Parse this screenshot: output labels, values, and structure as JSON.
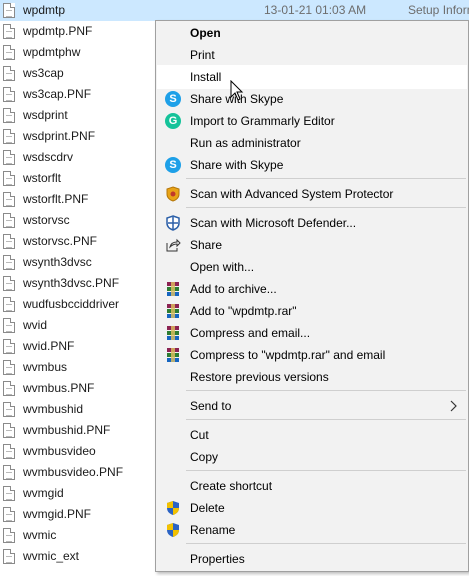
{
  "files": [
    {
      "name": "wpdmtp",
      "date": "13-01-21 01:03 AM",
      "type": "Setup Inform",
      "selected": true
    },
    {
      "name": "wpdmtp.PNF"
    },
    {
      "name": "wpdmtphw"
    },
    {
      "name": "ws3cap"
    },
    {
      "name": "ws3cap.PNF"
    },
    {
      "name": "wsdprint"
    },
    {
      "name": "wsdprint.PNF"
    },
    {
      "name": "wsdscdrv"
    },
    {
      "name": "wstorflt"
    },
    {
      "name": "wstorflt.PNF"
    },
    {
      "name": "wstorvsc"
    },
    {
      "name": "wstorvsc.PNF"
    },
    {
      "name": "wsynth3dvsc"
    },
    {
      "name": "wsynth3dvsc.PNF"
    },
    {
      "name": "wudfusbcciddriver"
    },
    {
      "name": "wvid"
    },
    {
      "name": "wvid.PNF"
    },
    {
      "name": "wvmbus"
    },
    {
      "name": "wvmbus.PNF"
    },
    {
      "name": "wvmbushid"
    },
    {
      "name": "wvmbushid.PNF"
    },
    {
      "name": "wvmbusvideo"
    },
    {
      "name": "wvmbusvideo.PNF"
    },
    {
      "name": "wvmgid"
    },
    {
      "name": "wvmgid.PNF"
    },
    {
      "name": "wvmic"
    },
    {
      "name": "wvmic_ext"
    }
  ],
  "menu": {
    "open": "Open",
    "print": "Print",
    "install": "Install",
    "share_skype_1": "Share with Skype",
    "grammarly": "Import to Grammarly Editor",
    "run_admin": "Run as administrator",
    "share_skype_2": "Share with Skype",
    "advanced_protector": "Scan with Advanced System Protector",
    "defender": "Scan with Microsoft Defender...",
    "share": "Share",
    "open_with": "Open with...",
    "add_archive": "Add to archive...",
    "add_rar": "Add to \"wpdmtp.rar\"",
    "compress_email": "Compress and email...",
    "compress_rar_email": "Compress to \"wpdmtp.rar\" and email",
    "restore": "Restore previous versions",
    "send_to": "Send to",
    "cut": "Cut",
    "copy": "Copy",
    "create_shortcut": "Create shortcut",
    "delete": "Delete",
    "rename": "Rename",
    "properties": "Properties"
  },
  "colors": {
    "selection": "#cce8ff",
    "menu_bg": "#f2f2f2",
    "skype": "#1ea0e8",
    "grammarly": "#15c39a"
  },
  "icons": {
    "skype": "S",
    "grammarly": "G"
  }
}
